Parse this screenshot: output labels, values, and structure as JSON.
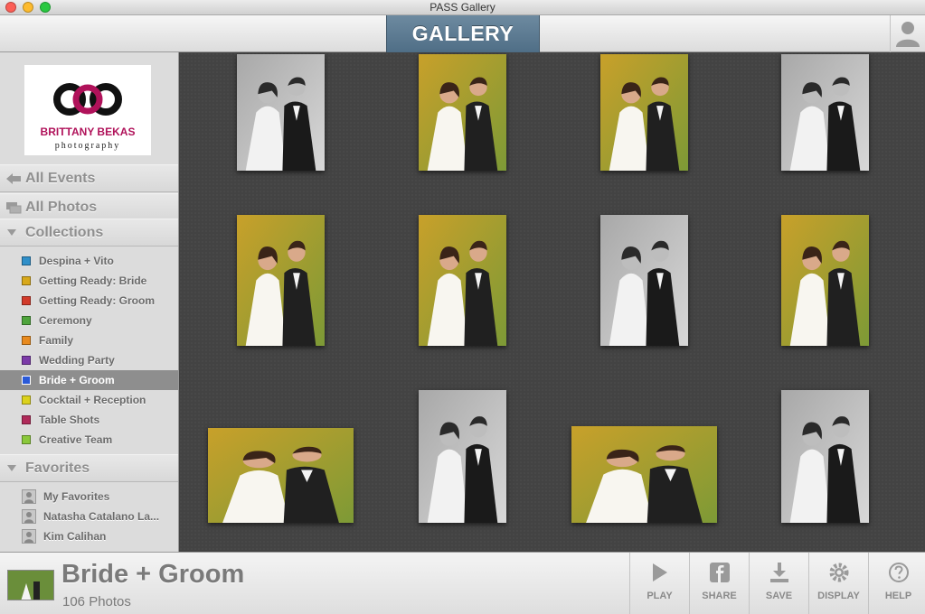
{
  "window": {
    "title": "PASS Gallery"
  },
  "toolbar": {
    "gallery_tab": "GALLERY"
  },
  "logo": {
    "line1": "BRITTANY BEKAS",
    "line2": "photography"
  },
  "sidebar": {
    "all_events": "All Events",
    "all_photos": "All Photos",
    "collections_header": "Collections",
    "collections": [
      {
        "label": "Despina + Vito",
        "color": "#2f8fc9"
      },
      {
        "label": "Getting Ready: Bride",
        "color": "#d8a81a"
      },
      {
        "label": "Getting Ready: Groom",
        "color": "#d23a2a"
      },
      {
        "label": "Ceremony",
        "color": "#4ea43c"
      },
      {
        "label": "Family",
        "color": "#e88a1e"
      },
      {
        "label": "Wedding Party",
        "color": "#7b3aa8"
      },
      {
        "label": "Bride + Groom",
        "color": "#2a5ad8",
        "selected": true
      },
      {
        "label": "Cocktail + Reception",
        "color": "#dcd21c"
      },
      {
        "label": "Table Shots",
        "color": "#b02a5a"
      },
      {
        "label": "Creative Team",
        "color": "#8ac83a"
      }
    ],
    "favorites_header": "Favorites",
    "favorites": [
      {
        "label": "My Favorites"
      },
      {
        "label": "Natasha Catalano La..."
      },
      {
        "label": "Kim Calihan"
      }
    ]
  },
  "footer": {
    "collection_title": "Bride + Groom",
    "photo_count": "106 Photos",
    "actions": [
      {
        "label": "PLAY",
        "icon": "play-icon"
      },
      {
        "label": "SHARE",
        "icon": "facebook-icon"
      },
      {
        "label": "SAVE",
        "icon": "download-icon"
      },
      {
        "label": "DISPLAY",
        "icon": "gear-icon"
      },
      {
        "label": "HELP",
        "icon": "help-icon"
      }
    ]
  },
  "photos": [
    {
      "name": "photo-1",
      "tone": "bw"
    },
    {
      "name": "photo-2",
      "tone": "color"
    },
    {
      "name": "photo-3",
      "tone": "color"
    },
    {
      "name": "photo-4",
      "tone": "bw"
    },
    {
      "name": "photo-5",
      "tone": "color"
    },
    {
      "name": "photo-6",
      "tone": "color"
    },
    {
      "name": "photo-7",
      "tone": "bw"
    },
    {
      "name": "photo-8",
      "tone": "color"
    },
    {
      "name": "photo-9",
      "tone": "color"
    },
    {
      "name": "photo-10",
      "tone": "bw"
    },
    {
      "name": "photo-11",
      "tone": "color"
    },
    {
      "name": "photo-12",
      "tone": "bw"
    }
  ]
}
